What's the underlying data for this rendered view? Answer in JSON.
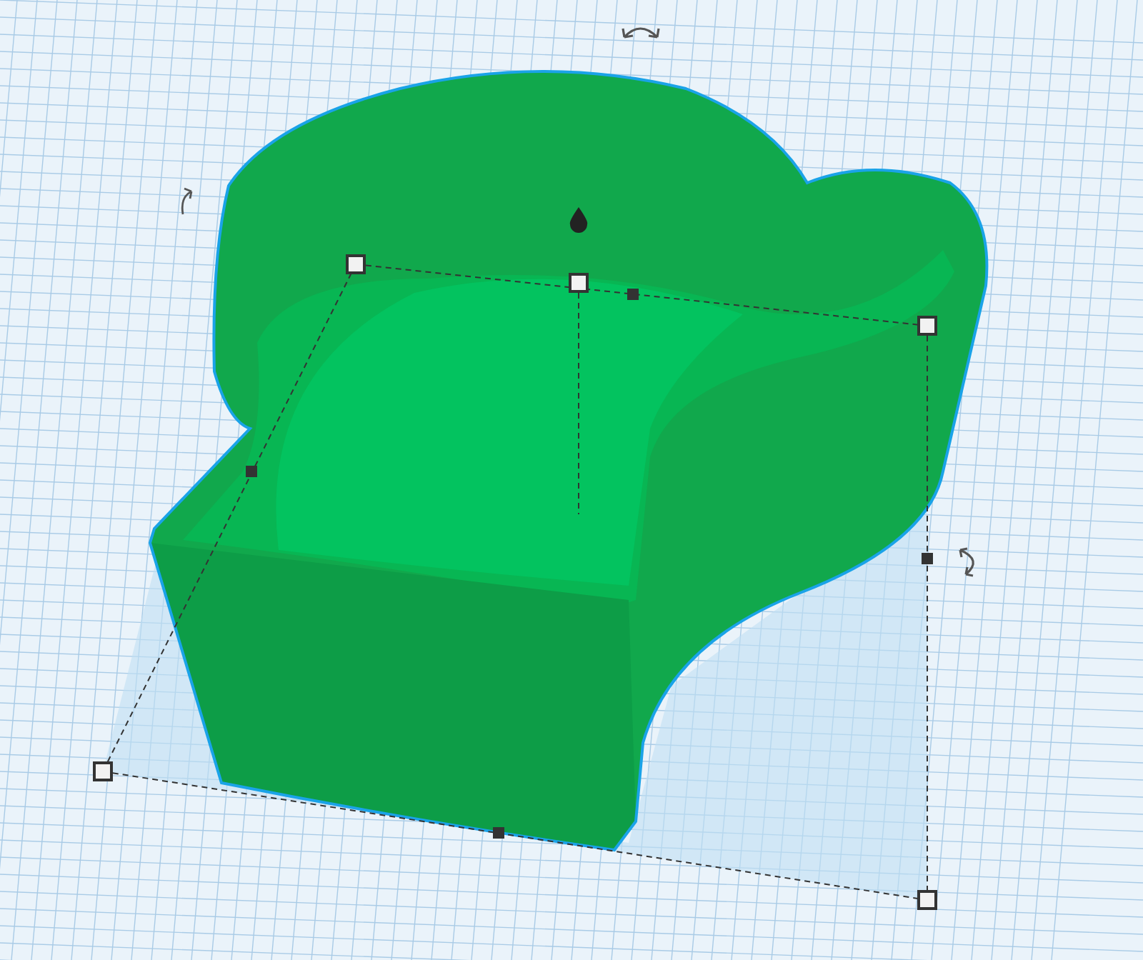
{
  "workplane": {
    "shape": {
      "selected": true
    }
  }
}
